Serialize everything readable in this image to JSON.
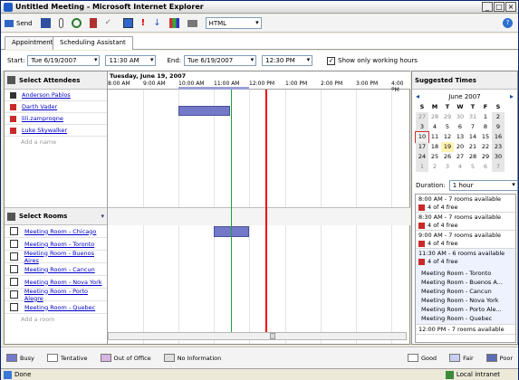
{
  "window": {
    "title": "Untitled Meeting - Microsoft Internet Explorer"
  },
  "toolbar": {
    "send_label": "Send",
    "format_value": "HTML"
  },
  "tabs": [
    "Appointment",
    "Scheduling Assistant"
  ],
  "times": {
    "start_label": "Start:",
    "start_date": "Tue 6/19/2007",
    "start_time": "11:30 AM",
    "end_label": "End:",
    "end_date": "Tue 6/19/2007",
    "end_time": "12:30 PM",
    "working_hours_label": "Show only working hours"
  },
  "attendees": {
    "header": "Select Attendees",
    "people": [
      {
        "name": "Anderson Pablos",
        "role_color": "#333333"
      },
      {
        "name": "Darth Vader",
        "role_color": "#c92a2a"
      },
      {
        "name": "lili.zamprogne",
        "role_color": "#c92a2a"
      },
      {
        "name": "Luke Skywalker",
        "role_color": "#c92a2a"
      }
    ],
    "add_placeholder": "Add a name"
  },
  "timeline": {
    "date_label": "Tuesday, June 19, 2007",
    "hours": [
      "8:00 AM",
      "9:00 AM",
      "10:00 AM",
      "11:00 AM",
      "12:00 PM",
      "1:00 PM",
      "2:00 PM",
      "3:00 PM",
      "4:00 PM"
    ]
  },
  "rooms": {
    "header": "Select Rooms",
    "items": [
      "Meeting Room - Chicago",
      "Meeting Room - Toronto",
      "Meeting Room - Buenos Aires",
      "Meeting Room - Cancun",
      "Meeting Room - Nova York",
      "Meeting Room - Porto Alegre",
      "Meeting Room - Quebec"
    ],
    "add_placeholder": "Add a room"
  },
  "legend": {
    "busy": "Busy",
    "tentative": "Tentative",
    "oof": "Out of Office",
    "noinfo": "No Information",
    "good": "Good",
    "fair": "Fair",
    "poor": "Poor",
    "colors": {
      "busy": "#7478c9",
      "tentative": "#ffffff",
      "oof": "#d8b4e2",
      "noinfo": "#e0e0e0",
      "good": "#ffffff",
      "fair": "#c8cff0",
      "poor": "#5d6bb5"
    }
  },
  "suggested": {
    "header": "Suggested Times",
    "month_label": "June 2007",
    "weekdays": [
      "S",
      "M",
      "T",
      "W",
      "T",
      "F",
      "S"
    ],
    "days": [
      [
        "27",
        "28",
        "29",
        "30",
        "31",
        "1",
        "2"
      ],
      [
        "3",
        "4",
        "5",
        "6",
        "7",
        "8",
        "9"
      ],
      [
        "10",
        "11",
        "12",
        "13",
        "14",
        "15",
        "16"
      ],
      [
        "17",
        "18",
        "19",
        "20",
        "21",
        "22",
        "23"
      ],
      [
        "24",
        "25",
        "26",
        "27",
        "28",
        "29",
        "30"
      ],
      [
        "1",
        "2",
        "3",
        "4",
        "5",
        "6",
        "7"
      ]
    ],
    "duration_label": "Duration:",
    "duration_value": "1 hour",
    "slots": [
      {
        "time": "8:00 AM - 7 rooms available",
        "free": "4 of 4 free"
      },
      {
        "time": "8:30 AM - 7 rooms available",
        "free": "4 of 4 free"
      },
      {
        "time": "9:00 AM - 7 rooms available",
        "free": "4 of 4 free"
      },
      {
        "time": "11:30 AM - 6 rooms available",
        "free": "4 of 4 free"
      }
    ],
    "room_list": [
      "Meeting Room - Toronto",
      "Meeting Room - Buenos A...",
      "Meeting Room - Cancun",
      "Meeting Room - Nova York",
      "Meeting Room - Porto Ale...",
      "Meeting Room - Quebec"
    ],
    "next_slot": "12:00 PM - 7 rooms available"
  },
  "status": {
    "left": "Done",
    "zone": "Local intranet"
  }
}
